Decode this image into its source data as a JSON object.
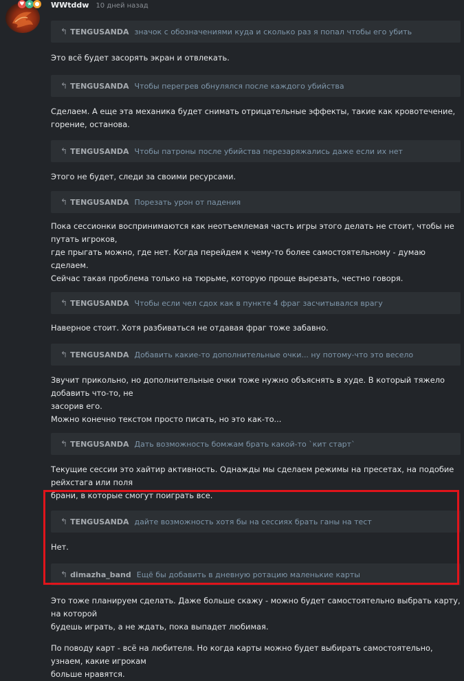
{
  "post": {
    "username": "WWtddw",
    "time": "10 дней назад",
    "badge_colors": [
      "#e6554a",
      "#3fb18c",
      "#f0a030"
    ],
    "highlight_color": "#e0141b"
  },
  "blocks": [
    {
      "quote_author": "TENGUSANDA",
      "quote_text": "значок с обозначениями куда и сколько раз я попал чтобы его убить",
      "reply": [
        "Это всё будет засорять экран и отвлекать."
      ]
    },
    {
      "quote_author": "TENGUSANDA",
      "quote_text": "Чтобы перегрев обнулялся после каждого убийства",
      "reply": [
        "Сделаем. А еще эта механика будет снимать отрицательные эффекты, такие как кровотечение, горение, останова."
      ]
    },
    {
      "quote_author": "TENGUSANDA",
      "quote_text": "Чтобы патроны после убийства перезаряжались даже если их нет",
      "reply": [
        "Этого не будет, следи за своими ресурсами."
      ]
    },
    {
      "quote_author": "TENGUSANDA",
      "quote_text": "Порезать урон от падения",
      "reply": [
        "Пока сессионки воспринимаются как неотъемлемая часть игры этого делать не стоит, чтобы не путать игроков,",
        "где прыгать можно, где нет. Когда перейдем к чему-то более самостоятельному - думаю сделаем.",
        "Сейчас такая проблема только на тюрьме, которую проще вырезать, честно говоря."
      ]
    },
    {
      "quote_author": "TENGUSANDA",
      "quote_text": "Чтобы если чел сдох как в пункте 4 фраг засчитывался врагу",
      "reply": [
        "Наверное стоит. Хотя разбиваться не отдавая фраг тоже забавно."
      ]
    },
    {
      "quote_author": "TENGUSANDA",
      "quote_text": "Добавить какие-то дополнительные очки... ну потому-что это весело",
      "reply": [
        "Звучит прикольно, но дополнительные очки тоже нужно объяснять в худе. В который тяжело добавить что-то, не",
        "засорив его.",
        "Можно конечно текстом просто писать, но это как-то..."
      ]
    },
    {
      "quote_author": "TENGUSANDA",
      "quote_text": "Дать возможность бомжам брать какой-то `кит старт`",
      "reply": [
        "Текущие сессии это хайтир активность. Однажды мы сделаем режимы на пресетах, на подобие рейхстага или поля",
        "брани, в которые смогут поиграть все."
      ]
    },
    {
      "quote_author": "TENGUSANDA",
      "quote_text": "дайте возможность хотя бы на сессиях брать ганы на тест",
      "reply": [
        "Нет."
      ]
    },
    {
      "quote_author": "dimazha_band",
      "quote_text": "Ещё бы добавить в дневную ротацию маленькие карты",
      "reply": [
        "Это тоже планируем сделать. Даже больше скажу - можно будет самостоятельно выбрать карту, на которой",
        "будешь играть, а не ждать, пока выпадет любимая.",
        "",
        "По поводу карт - всё на любителя. Но когда карты можно будет выбирать самостоятельно, узнаем, какие игрокам",
        "больше нравятся."
      ]
    }
  ]
}
